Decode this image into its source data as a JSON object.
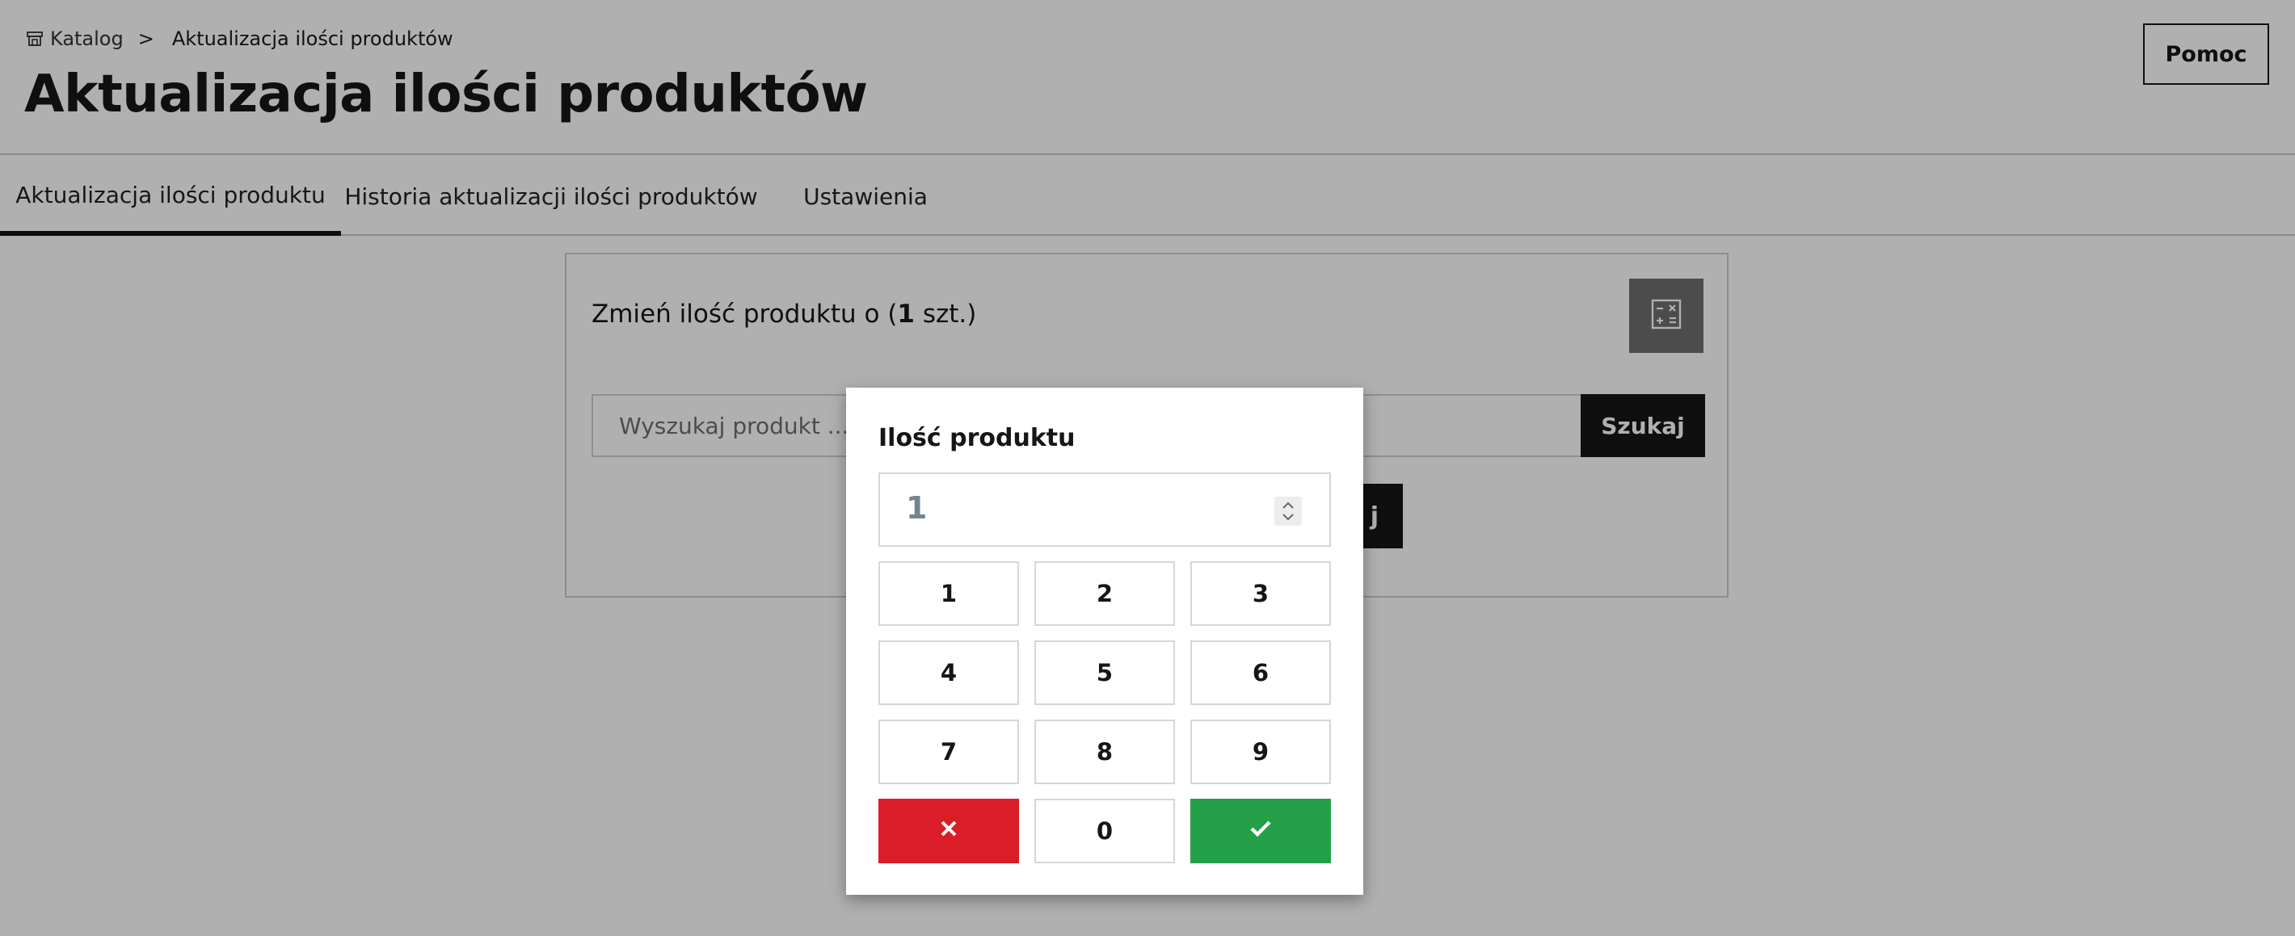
{
  "breadcrumb": {
    "root_label": "Katalog",
    "separator": ">",
    "current_label": "Aktualizacja ilości produktów"
  },
  "header": {
    "title": "Aktualizacja ilości produktów",
    "help_label": "Pomoc"
  },
  "tabs": [
    {
      "label": "Aktualizacja ilości produktu",
      "active": true
    },
    {
      "label": "Historia aktualizacji ilości produktów",
      "active": false
    },
    {
      "label": "Ustawienia",
      "active": false
    }
  ],
  "card": {
    "change_prefix": "Zmień ilość produktu o (",
    "change_amount": "1",
    "change_suffix": " szt.)",
    "search_placeholder": "Wyszukaj produkt ...",
    "search_button_label": "Szukaj",
    "secondary_button_visible_text": "j"
  },
  "modal": {
    "title": "Ilość produktu",
    "quantity_value": "1",
    "keys": [
      "1",
      "2",
      "3",
      "4",
      "5",
      "6",
      "7",
      "8",
      "9",
      "0"
    ]
  },
  "colors": {
    "cancel": "#da1e28",
    "confirm": "#24a148",
    "primary": "#161616"
  },
  "icons": {
    "breadcrumb": "store-icon",
    "calculator": "calculator-icon",
    "cancel": "close-icon",
    "confirm": "checkmark-icon",
    "spinner": "chevron-updown-icon"
  }
}
